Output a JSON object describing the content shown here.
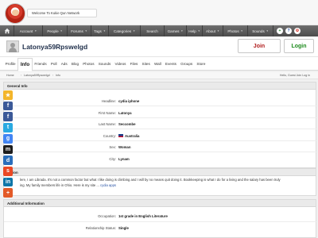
{
  "header": {
    "welcome": "Welcome To Kukie Qun Network"
  },
  "nav": {
    "items": [
      {
        "label": "Account",
        "dropdown": true
      },
      {
        "label": "People",
        "dropdown": true
      },
      {
        "label": "Forums",
        "dropdown": true
      },
      {
        "label": "Tags",
        "dropdown": true
      },
      {
        "label": "Categories",
        "dropdown": true
      },
      {
        "label": "Search",
        "dropdown": false
      },
      {
        "label": "Games",
        "dropdown": true
      },
      {
        "label": "Help",
        "dropdown": true
      },
      {
        "label": "About",
        "dropdown": true
      },
      {
        "label": "Photos",
        "dropdown": true
      },
      {
        "label": "Sounds",
        "dropdown": true
      }
    ],
    "plus_icon": "+",
    "colors": {
      "plus": "#1e7f2a",
      "help": "#2a55a5",
      "settings": "#d4372d"
    }
  },
  "profile": {
    "name": "Latonya59Rpswelgd",
    "join_label": "Join",
    "login_label": "Login"
  },
  "tabs": [
    "Profile",
    "Info",
    "Friends",
    "Poll",
    "Ads",
    "Blog",
    "Photos",
    "Sounds",
    "Videos",
    "Files",
    "Sites",
    "Wall",
    "Events",
    "Groups",
    "Store"
  ],
  "active_tab": "Info",
  "breadcrumb": {
    "home": "Home",
    "user": "Latonya59Rpswelgd",
    "current": "Info",
    "right": "Hello, Guest   Join  Log in"
  },
  "general_info": {
    "title": "General Info",
    "rows": [
      {
        "label": "Headline:",
        "value": "cydia iphone"
      },
      {
        "label": "First Name:",
        "value": "Latonya"
      },
      {
        "label": "Last Name:",
        "value": "Seccombe"
      },
      {
        "label": "Country:",
        "value": "Australia"
      },
      {
        "label": "Sex:",
        "value": "Woman"
      },
      {
        "label": "City:",
        "value": "Lynam"
      }
    ]
  },
  "description": {
    "title": "ription",
    "line1": "lere, I am Librada. It's not a common factor but what I like doing is climbing and I will by no means quit doing it. Bookkeeping is what I do for a living and the salary has been truly",
    "line2": "ing. My family members life in Ohio. Here is my site ...",
    "more": "cydia apps"
  },
  "additional_info": {
    "title": "Additional Information",
    "rows": [
      {
        "label": "Occupation:",
        "value": "1st grade in English Literature"
      },
      {
        "label": "Relationship Status:",
        "value": "Single"
      }
    ]
  },
  "share_icons": [
    {
      "name": "favorite-star-icon",
      "glyph": "★",
      "color": "#f3b52a"
    },
    {
      "name": "facebook-icon",
      "glyph": "f",
      "color": "#3b5998"
    },
    {
      "name": "facebook-like-icon",
      "glyph": "f",
      "color": "#3b5998"
    },
    {
      "name": "twitter-icon",
      "glyph": "t",
      "color": "#29a9e1"
    },
    {
      "name": "google-icon",
      "glyph": "g",
      "color": "#4285f4"
    },
    {
      "name": "myspace-icon",
      "glyph": "m",
      "color": "#1d1d1d"
    },
    {
      "name": "delicious-icon",
      "glyph": "d",
      "color": "#2a6ebb"
    },
    {
      "name": "stumbleupon-icon",
      "glyph": "s",
      "color": "#eb4924"
    },
    {
      "name": "linkedin-icon",
      "glyph": "in",
      "color": "#0e76a8"
    },
    {
      "name": "more-share-icon",
      "glyph": "+",
      "color": "#e35a28"
    }
  ]
}
